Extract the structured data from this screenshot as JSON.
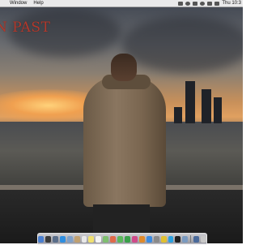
{
  "menubar": {
    "items": [
      "Window",
      "Help"
    ],
    "clock": "Thu 10:3"
  },
  "desktop": {
    "wallpaper_text": "N PAST"
  },
  "dock": {
    "apps": [
      {
        "name": "finder-icon",
        "color": "#4a7fd0"
      },
      {
        "name": "dashboard-icon",
        "color": "#3a3a3a"
      },
      {
        "name": "mission-control-icon",
        "color": "#5a6e8a"
      },
      {
        "name": "safari-icon",
        "color": "#2f8ee0"
      },
      {
        "name": "mail-icon",
        "color": "#7fa0c8"
      },
      {
        "name": "contacts-icon",
        "color": "#c0a070"
      },
      {
        "name": "calendar-icon",
        "color": "#e8e8e8"
      },
      {
        "name": "notes-icon",
        "color": "#f0e070"
      },
      {
        "name": "reminders-icon",
        "color": "#f4f4f4"
      },
      {
        "name": "maps-icon",
        "color": "#7fbf70"
      },
      {
        "name": "photos-icon",
        "color": "#e06a4a"
      },
      {
        "name": "messages-icon",
        "color": "#5ab85a"
      },
      {
        "name": "facetime-icon",
        "color": "#3aa04a"
      },
      {
        "name": "itunes-icon",
        "color": "#d04a8a"
      },
      {
        "name": "ibooks-icon",
        "color": "#e08a2a"
      },
      {
        "name": "app-store-icon",
        "color": "#3a8ae0"
      },
      {
        "name": "system-preferences-icon",
        "color": "#8a8a8a"
      },
      {
        "name": "chrome-icon",
        "color": "#e0c030"
      },
      {
        "name": "skype-icon",
        "color": "#2aa0e0"
      },
      {
        "name": "terminal-icon",
        "color": "#202020"
      },
      {
        "name": "preview-icon",
        "color": "#7a9ac0"
      },
      {
        "name": "downloads-icon",
        "color": "#4a6a9a"
      },
      {
        "name": "trash-icon",
        "color": "#c8c8c8"
      }
    ]
  }
}
